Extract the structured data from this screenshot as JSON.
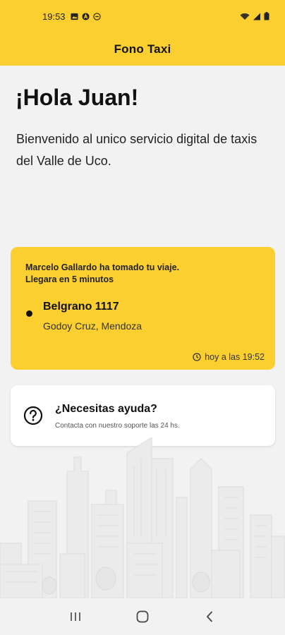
{
  "status_bar": {
    "time": "19:53",
    "icons_left": [
      "image-icon",
      "a-circle-icon",
      "minus-circle-icon"
    ],
    "icons_right": [
      "wifi-icon",
      "signal-icon",
      "battery-icon"
    ]
  },
  "app_bar": {
    "title": "Fono Taxi"
  },
  "greeting": "¡Hola Juan!",
  "welcome": "Bienvenido al unico servicio digital de taxis del Valle de Uco.",
  "trip_card": {
    "message_line1": "Marcelo Gallardo ha tomado tu viaje.",
    "message_line2": "Llegara en 5 minutos",
    "address": "Belgrano 1117",
    "city": "Godoy Cruz, Mendoza",
    "time": "hoy a las 19:52"
  },
  "help_card": {
    "title": "¿Necesitas ayuda?",
    "subtitle": "Contacta con nuestro soporte las 24 hs."
  },
  "nav_bar": {
    "buttons": [
      "recent-apps",
      "home",
      "back"
    ]
  },
  "colors": {
    "accent": "#fbcf2f",
    "background": "#f2f2f2",
    "card": "#ffffff"
  }
}
